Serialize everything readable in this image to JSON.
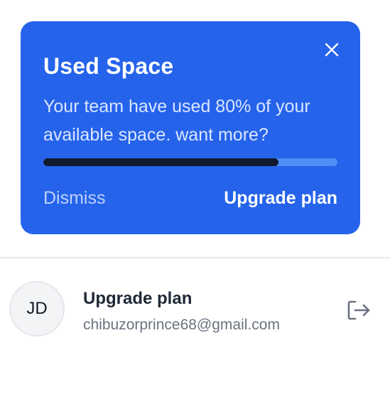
{
  "usage_card": {
    "title": "Used Space",
    "description": "Your team have used 80% of your available space. want more?",
    "progress_fraction": 0.8,
    "dismiss_label": "Dismiss",
    "upgrade_label": "Upgrade plan",
    "close_icon": "close-icon"
  },
  "user": {
    "initials": "JD",
    "name": "Upgrade plan",
    "email": "chibuzorprince68@gmail.com",
    "logout_icon": "logout-icon"
  },
  "colors": {
    "card_background": "#2563eb",
    "progress_fill": "#111a2e",
    "progress_track": "#4f8ef7"
  }
}
